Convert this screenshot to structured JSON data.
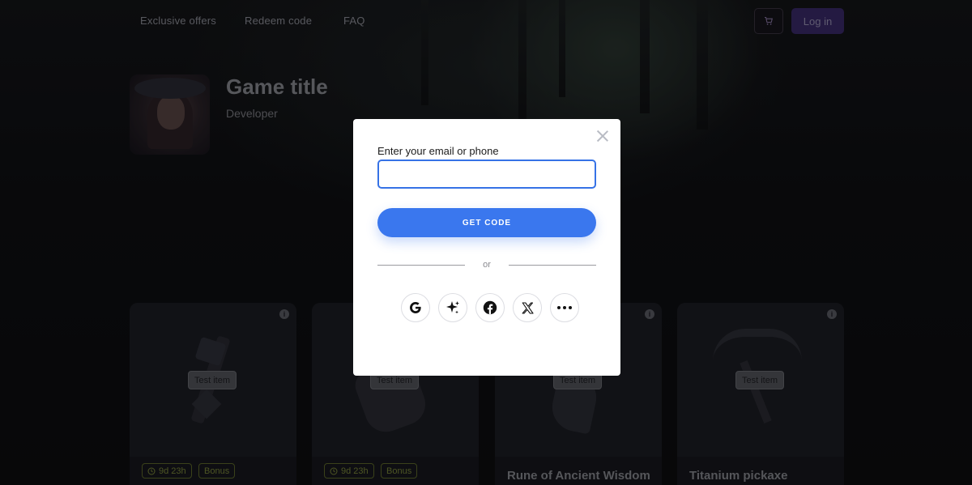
{
  "nav": {
    "links": [
      "Exclusive offers",
      "Redeem code",
      "FAQ"
    ],
    "login_label": "Log in",
    "cart_icon": "cart-icon"
  },
  "game": {
    "title": "Game title",
    "developer": "Developer"
  },
  "cards": [
    {
      "tag": "Test item",
      "timer": "9d 23h",
      "bonus": "Bonus",
      "name": ""
    },
    {
      "tag": "Test item",
      "timer": "9d 23h",
      "bonus": "Bonus",
      "name": ""
    },
    {
      "tag": "Test item",
      "timer": "",
      "bonus": "",
      "name": "Rune of Ancient Wisdom"
    },
    {
      "tag": "Test item",
      "timer": "",
      "bonus": "",
      "name": "Titanium pickaxe"
    }
  ],
  "modal": {
    "field_label": "Enter your email or phone",
    "input_value": "",
    "get_code_label": "GET CODE",
    "divider_text": "or",
    "social_icons": [
      "google-icon",
      "sparkle-icon",
      "facebook-icon",
      "x-icon",
      "more-icon"
    ]
  },
  "colors": {
    "primary_button": "#3a77ee",
    "input_border": "#3672e6",
    "login_button": "#3b2a6b",
    "badge_text": "#7d8a3a"
  }
}
